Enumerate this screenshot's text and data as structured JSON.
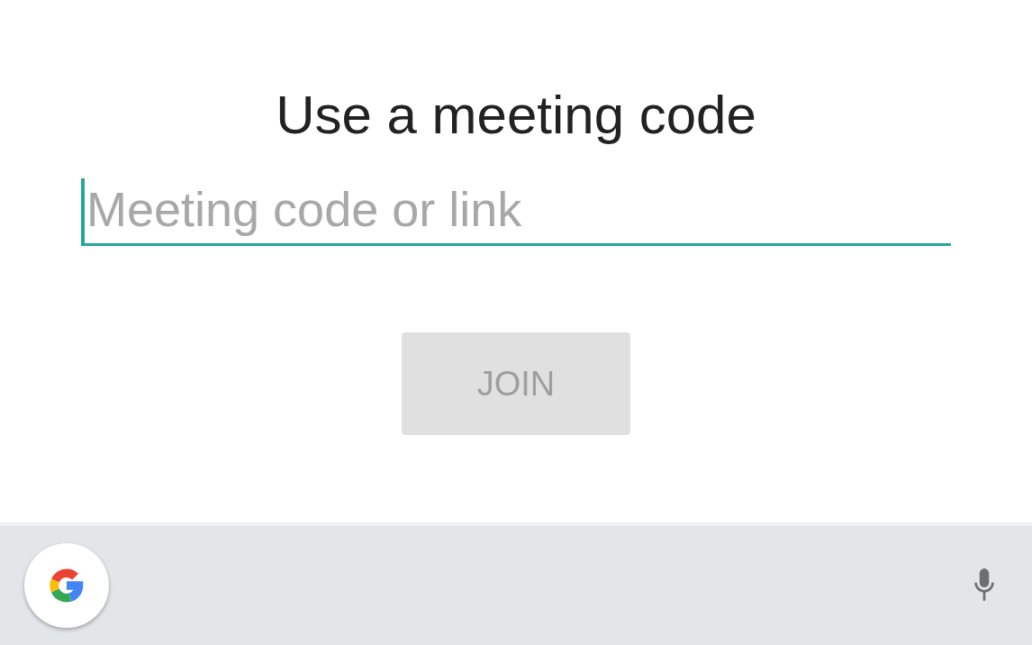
{
  "title": "Use a meeting code",
  "code_field": {
    "placeholder": "Meeting code or link",
    "focused": true
  },
  "join_button": {
    "label": "JOIN",
    "disabled": true
  }
}
